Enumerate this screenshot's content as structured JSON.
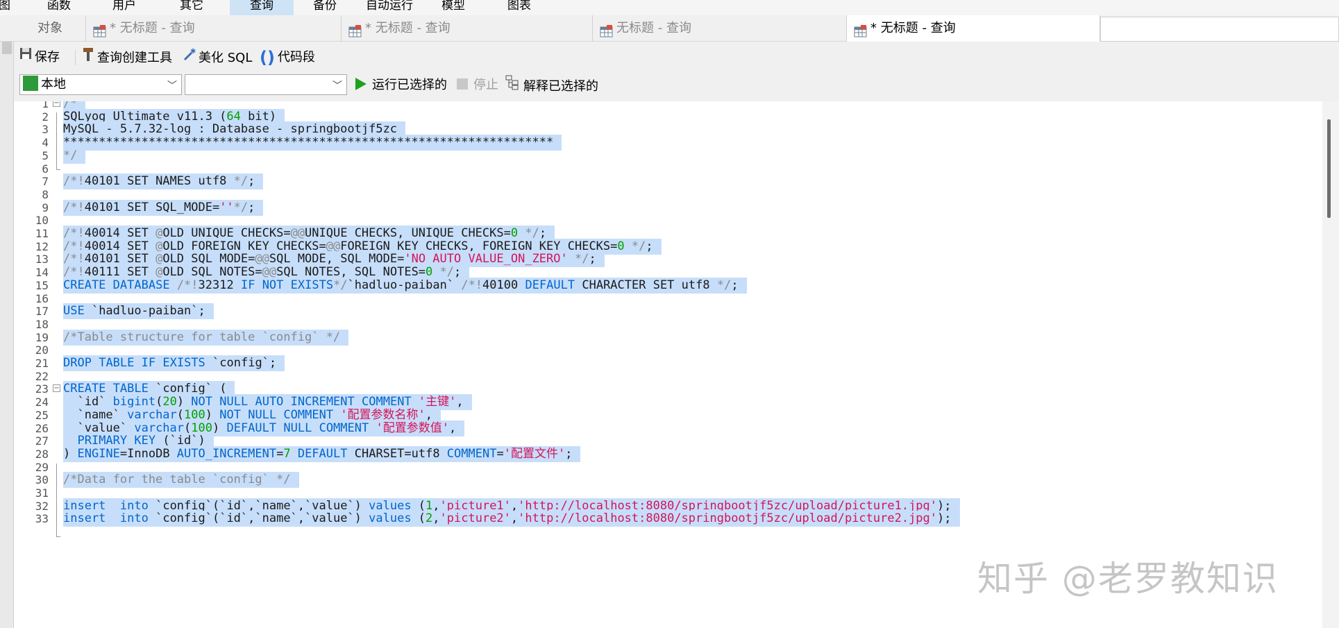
{
  "menu": [
    {
      "label": "图",
      "active": false
    },
    {
      "label": "函数",
      "active": false
    },
    {
      "label": "用户",
      "active": false
    },
    {
      "label": "其它",
      "active": false
    },
    {
      "label": "查询",
      "active": true
    },
    {
      "label": "备份",
      "active": false
    },
    {
      "label": "自动运行",
      "active": false
    },
    {
      "label": "模型",
      "active": false
    },
    {
      "label": "图表",
      "active": false
    }
  ],
  "tabs": [
    {
      "label": "对象",
      "active": false
    },
    {
      "label": "* 无标题 - 查询",
      "active": false
    },
    {
      "label": "* 无标题 - 查询",
      "active": false
    },
    {
      "label": "无标题 - 查询",
      "active": false
    },
    {
      "label": "* 无标题 - 查询",
      "active": true
    }
  ],
  "toolbar": {
    "save": "保存",
    "query_builder": "查询创建工具",
    "beautify": "美化 SQL",
    "snippet": "代码段"
  },
  "db_row": {
    "connection": "本地",
    "database": "",
    "run_selected": "运行已选择的",
    "stop": "停止",
    "explain_selected": "解释已选择的"
  },
  "editor": {
    "lines": [
      {
        "n": "1",
        "text": "/*"
      },
      {
        "n": "2",
        "text": "SQLyog Ultimate v11.3 (64 bit)"
      },
      {
        "n": "3",
        "text": "MySQL - 5.7.32-log : Database - springbootjf5zc"
      },
      {
        "n": "4",
        "text": "*********************************************************************"
      },
      {
        "n": "5",
        "text": "*/"
      },
      {
        "n": "6",
        "text": ""
      },
      {
        "n": "7",
        "text": "/*!40101 SET NAMES utf8 */;"
      },
      {
        "n": "8",
        "text": ""
      },
      {
        "n": "9",
        "text": "/*!40101 SET SQL_MODE=''*/;"
      },
      {
        "n": "10",
        "text": ""
      },
      {
        "n": "11",
        "text": "/*!40014 SET @OLD_UNIQUE_CHECKS=@@UNIQUE_CHECKS, UNIQUE_CHECKS=0 */;"
      },
      {
        "n": "12",
        "text": "/*!40014 SET @OLD_FOREIGN_KEY_CHECKS=@@FOREIGN_KEY_CHECKS, FOREIGN_KEY_CHECKS=0 */;"
      },
      {
        "n": "13",
        "text": "/*!40101 SET @OLD_SQL_MODE=@@SQL_MODE, SQL_MODE='NO_AUTO_VALUE_ON_ZERO' */;"
      },
      {
        "n": "14",
        "text": "/*!40111 SET @OLD_SQL_NOTES=@@SQL_NOTES, SQL_NOTES=0 */;"
      },
      {
        "n": "15",
        "text": "CREATE DATABASE /*!32312 IF NOT EXISTS*/`hadluo-paiban` /*!40100 DEFAULT CHARACTER SET utf8 */;"
      },
      {
        "n": "16",
        "text": ""
      },
      {
        "n": "17",
        "text": "USE `hadluo-paiban`;"
      },
      {
        "n": "18",
        "text": ""
      },
      {
        "n": "19",
        "text": "/*Table structure for table `config` */"
      },
      {
        "n": "20",
        "text": ""
      },
      {
        "n": "21",
        "text": "DROP TABLE IF EXISTS `config`;"
      },
      {
        "n": "22",
        "text": ""
      },
      {
        "n": "23",
        "text": "CREATE TABLE `config` ("
      },
      {
        "n": "24",
        "text": "  `id` bigint(20) NOT NULL AUTO_INCREMENT COMMENT '主键',"
      },
      {
        "n": "25",
        "text": "  `name` varchar(100) NOT NULL COMMENT '配置参数名称',"
      },
      {
        "n": "26",
        "text": "  `value` varchar(100) DEFAULT NULL COMMENT '配置参数值',"
      },
      {
        "n": "27",
        "text": "  PRIMARY KEY (`id`)"
      },
      {
        "n": "28",
        "text": ") ENGINE=InnoDB AUTO_INCREMENT=7 DEFAULT CHARSET=utf8 COMMENT='配置文件';"
      },
      {
        "n": "29",
        "text": ""
      },
      {
        "n": "30",
        "text": "/*Data for the table `config` */"
      },
      {
        "n": "31",
        "text": ""
      },
      {
        "n": "32",
        "text": "insert  into `config`(`id`,`name`,`value`) values (1,'picture1','http://localhost:8080/springbootjf5zc/upload/picture1.jpg');"
      },
      {
        "n": "33",
        "text": "insert  into `config`(`id`,`name`,`value`) values (2,'picture2','http://localhost:8080/springbootjf5zc/upload/picture2.jpg');"
      }
    ]
  },
  "watermark": "知乎 @老罗教知识",
  "colors": {
    "selection": "#c7defa",
    "keyword": "#0066cc",
    "comment": "#8a8a8a",
    "string": "#d4145a",
    "number": "#00a000",
    "active_menu": "#cfe3f6",
    "run_icon": "#1ea11e"
  },
  "icons": [
    "save-icon",
    "hammer-icon",
    "magic-wand-icon",
    "brackets-icon",
    "connection-icon",
    "play-icon",
    "stop-icon",
    "explain-icon",
    "table-icon"
  ]
}
